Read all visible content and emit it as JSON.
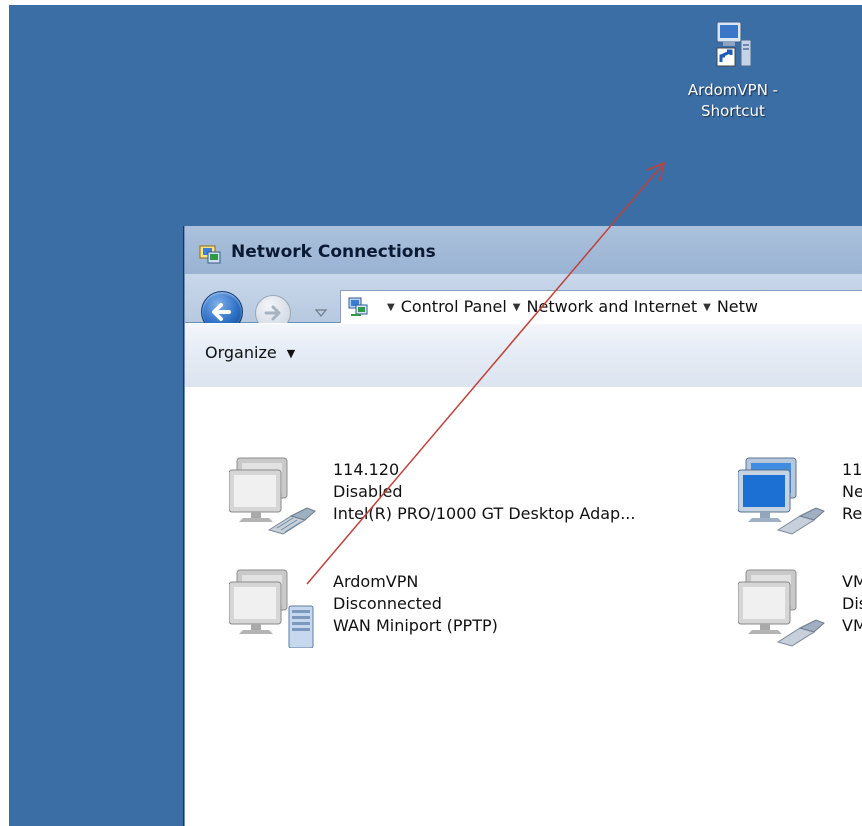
{
  "desktop": {
    "shortcut": {
      "label": "ArdomVPN -\nShortcut"
    }
  },
  "window": {
    "title": "Network Connections",
    "breadcrumb": [
      "Control Panel",
      "Network and Internet",
      "Netw"
    ],
    "toolbar": {
      "organize_label": "Organize"
    }
  },
  "connections": [
    {
      "name": "114.120",
      "status": "Disabled",
      "device": "Intel(R) PRO/1000 GT Desktop Adap...",
      "icon": "network-adapter-disabled-icon"
    },
    {
      "name": "ArdomVPN",
      "status": "Disconnected",
      "device": "WAN Miniport (PPTP)",
      "icon": "vpn-connection-icon"
    },
    {
      "name": "11",
      "status": "Ne",
      "device": "Re",
      "icon": "network-adapter-connected-icon"
    },
    {
      "name": "VM",
      "status": "Dis",
      "device": "VM",
      "icon": "network-adapter-disabled-icon"
    }
  ],
  "colors": {
    "desktop": "#3a6ea5",
    "titlebar": "#9ab3d4",
    "annotation_arrow": "#c0413a"
  }
}
